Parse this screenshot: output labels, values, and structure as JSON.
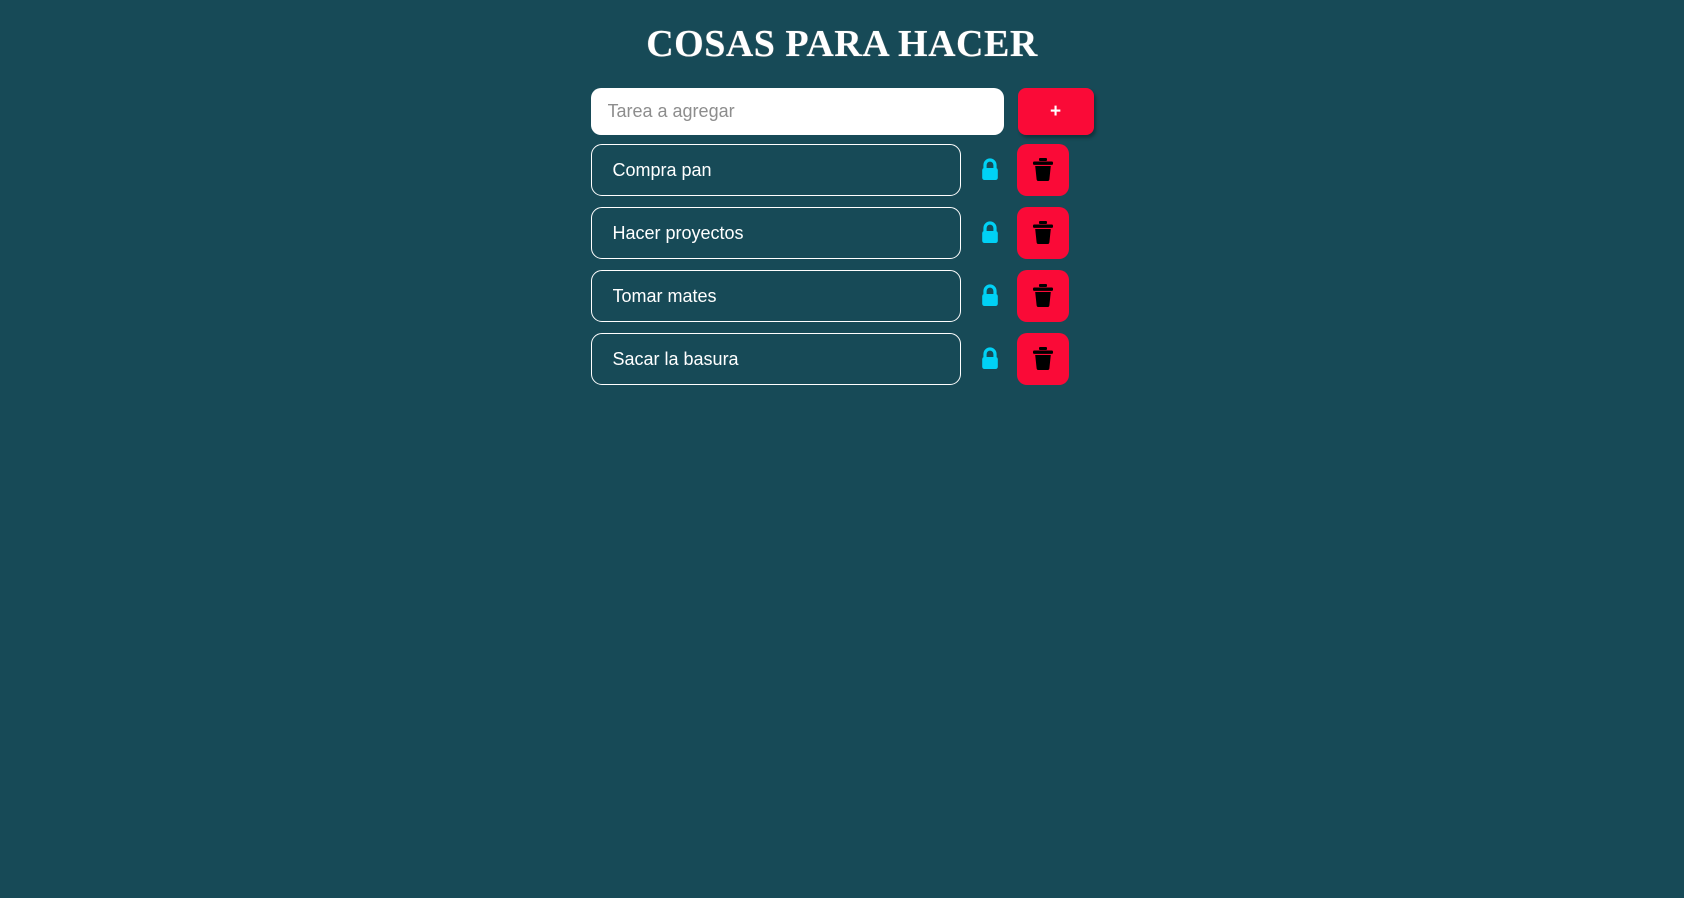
{
  "app": {
    "title": "COSAS PARA HACER",
    "background_color": "#174a57",
    "accent_red": "#fa0a37",
    "lock_cyan": "#00d1f5",
    "text_color": "#ffffff"
  },
  "add_task": {
    "placeholder": "Tarea a agregar",
    "value": "",
    "button_label": "+",
    "button_icon": "plus-icon"
  },
  "tasks": [
    {
      "text": "Compra pan",
      "lock_icon": "lock-closed-icon",
      "delete_icon": "trash-icon"
    },
    {
      "text": "Hacer proyectos",
      "lock_icon": "lock-closed-icon",
      "delete_icon": "trash-icon"
    },
    {
      "text": "Tomar mates",
      "lock_icon": "lock-closed-icon",
      "delete_icon": "trash-icon"
    },
    {
      "text": "Sacar la basura",
      "lock_icon": "lock-closed-icon",
      "delete_icon": "trash-icon"
    }
  ]
}
